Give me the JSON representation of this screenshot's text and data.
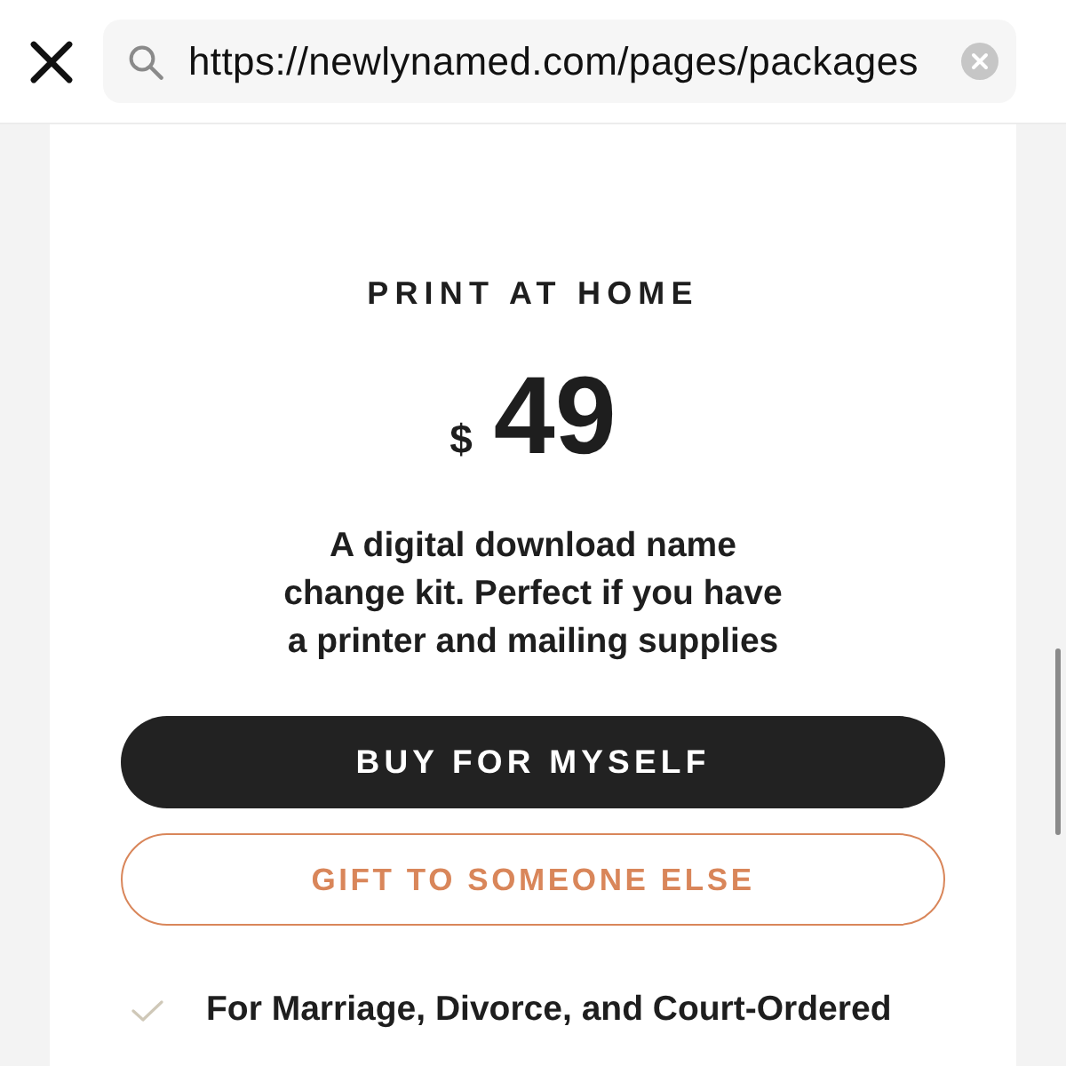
{
  "browser_bar": {
    "url": "https://newlynamed.com/pages/packages"
  },
  "package": {
    "title": "PRINT AT HOME",
    "currency": "$",
    "price": "49",
    "description": "A digital download name change kit. Perfect if you have a printer and mailing supplies",
    "buttons": [
      {
        "label": "BUY FOR MYSELF",
        "kind": "filled"
      },
      {
        "label": "GIFT TO SOMEONE ELSE",
        "kind": "outline"
      }
    ],
    "features": [
      {
        "text": "For Marriage, Divorce, and Court-Ordered"
      }
    ]
  }
}
